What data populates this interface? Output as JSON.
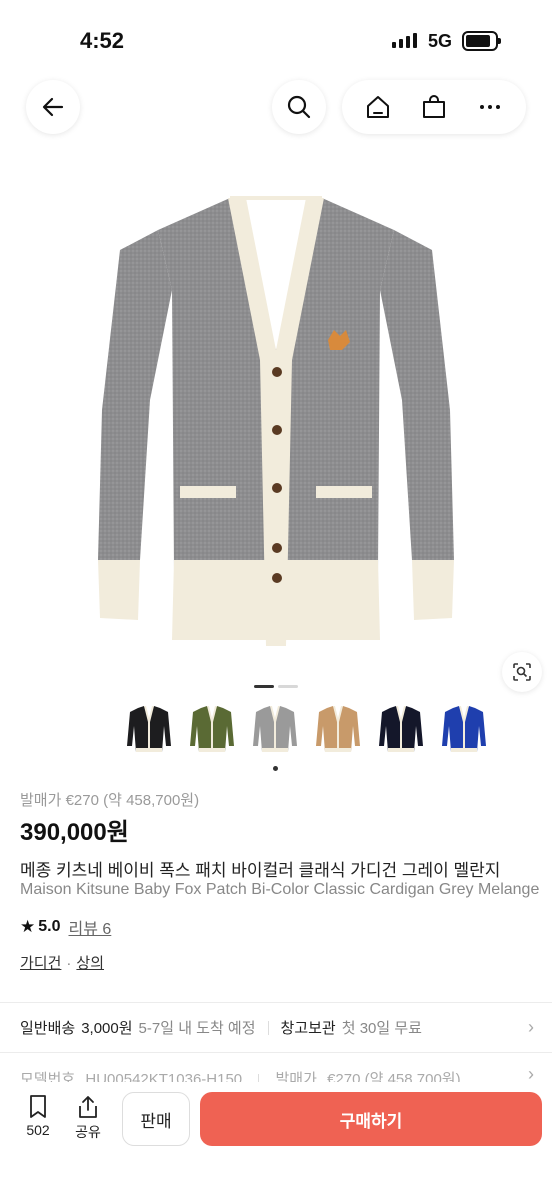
{
  "status_bar": {
    "time": "4:52",
    "network": "5G"
  },
  "icons": {
    "back": "arrow-left-icon",
    "search": "search-icon",
    "home": "home-icon",
    "shop": "shopping-bag-icon",
    "more": "more-icon",
    "lens": "lens-search-icon",
    "bookmark": "bookmark-icon",
    "share": "share-icon"
  },
  "product": {
    "original_price": "발매가 €270 (약 458,700원)",
    "price": "390,000원",
    "title_ko": "메종 키츠네 베이비 폭스 패치 바이컬러 클래식 가디건 그레이 멜란지",
    "title_en": "Maison Kitsune Baby Fox Patch Bi-Color Classic Cardigan Grey Melange",
    "rating": "5.0",
    "review": "리뷰 6",
    "categories": [
      "가디건",
      "상의"
    ],
    "colors": [
      "#1d1d1f",
      "#5a6a34",
      "#9a9a9a",
      "#c89a6a",
      "#14172a",
      "#1f3fae"
    ],
    "image_progress": 0.5
  },
  "shipping": {
    "label": "일반배송",
    "price": "3,000원",
    "eta": "5-7일 내 도착 예정",
    "storage_label": "창고보관",
    "storage_note": "첫 30일 무료"
  },
  "detail_row": {
    "model_label": "모델번호",
    "model_value": "HU00542KT1036-H150",
    "release_label": "발매가",
    "release_value": "€270 (약 458,700원)"
  },
  "bottom_bar": {
    "bookmark_count": "502",
    "share_label": "공유",
    "sell_label": "판매",
    "buy_label": "구매하기"
  },
  "colors": {
    "accent": "#ef6253"
  }
}
